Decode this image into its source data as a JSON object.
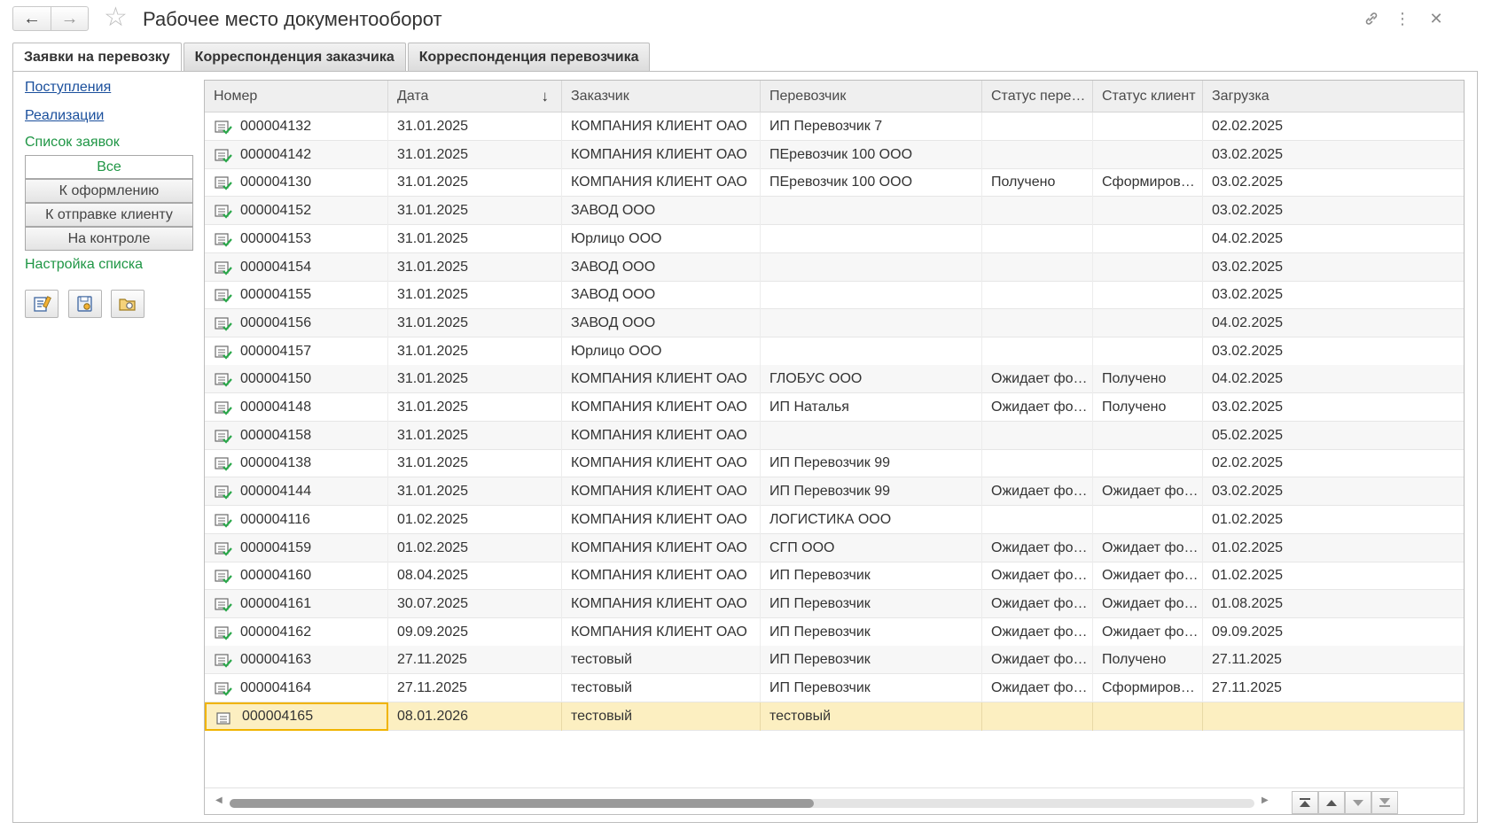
{
  "window": {
    "title": "Рабочее место документооборот",
    "back_icon": "arrow-left-icon",
    "forward_icon": "arrow-right-icon",
    "favorite_icon": "star-icon",
    "link_icon": "link-icon",
    "more_icon": "more-vertical-icon",
    "close_icon": "close-icon"
  },
  "tabs": [
    {
      "label": "Заявки на перевозку",
      "active": true
    },
    {
      "label": "Корреспонденция заказчика",
      "active": false
    },
    {
      "label": "Корреспонденция перевозчика",
      "active": false
    }
  ],
  "sidebar": {
    "links": [
      "Поступления",
      "Реализации"
    ],
    "list_title": "Список заявок",
    "filters": [
      {
        "label": "Все",
        "selected": true
      },
      {
        "label": "К оформлению",
        "selected": false
      },
      {
        "label": "К отправке клиенту",
        "selected": false
      },
      {
        "label": "На контроле",
        "selected": false
      }
    ],
    "settings_title": "Настройка списка",
    "settings_buttons": [
      "list-settings-icon",
      "settings-save-icon",
      "settings-load-icon"
    ]
  },
  "table": {
    "columns": [
      "Номер",
      "Дата",
      "Заказчик",
      "Перевозчик",
      "Статус пере…",
      "Статус клиент",
      "Загрузка"
    ],
    "sort_column": "Дата",
    "rows": [
      {
        "number": "000004132",
        "date": "31.01.2025",
        "customer": "КОМПАНИЯ КЛИЕНТ ОАО",
        "carrier": "ИП Перевозчик 7",
        "carrier_status": "",
        "client_status": "",
        "loading": "02.02.2025"
      },
      {
        "number": "000004142",
        "date": "31.01.2025",
        "customer": "КОМПАНИЯ КЛИЕНТ ОАО",
        "carrier": "ПЕревозчик 100 ООО",
        "carrier_status": "",
        "client_status": "",
        "loading": "03.02.2025"
      },
      {
        "number": "000004130",
        "date": "31.01.2025",
        "customer": "КОМПАНИЯ КЛИЕНТ ОАО",
        "carrier": "ПЕревозчик 100 ООО",
        "carrier_status": "Получено",
        "client_status": "Сформиров…",
        "loading": "03.02.2025"
      },
      {
        "number": "000004152",
        "date": "31.01.2025",
        "customer": "ЗАВОД ООО",
        "carrier": "",
        "carrier_status": "",
        "client_status": "",
        "loading": "03.02.2025"
      },
      {
        "number": "000004153",
        "date": "31.01.2025",
        "customer": "Юрлицо ООО",
        "carrier": "",
        "carrier_status": "",
        "client_status": "",
        "loading": "04.02.2025"
      },
      {
        "number": "000004154",
        "date": "31.01.2025",
        "customer": "ЗАВОД ООО",
        "carrier": "",
        "carrier_status": "",
        "client_status": "",
        "loading": "03.02.2025"
      },
      {
        "number": "000004155",
        "date": "31.01.2025",
        "customer": "ЗАВОД ООО",
        "carrier": "",
        "carrier_status": "",
        "client_status": "",
        "loading": "03.02.2025"
      },
      {
        "number": "000004156",
        "date": "31.01.2025",
        "customer": "ЗАВОД ООО",
        "carrier": "",
        "carrier_status": "",
        "client_status": "",
        "loading": "04.02.2025"
      },
      {
        "number": "000004157",
        "date": "31.01.2025",
        "customer": "Юрлицо ООО",
        "carrier": "",
        "carrier_status": "",
        "client_status": "",
        "loading": "03.02.2025"
      },
      {
        "number": "000004150",
        "date": "31.01.2025",
        "customer": "КОМПАНИЯ КЛИЕНТ ОАО",
        "carrier": "ГЛОБУС ООО",
        "carrier_status": "Ожидает фо…",
        "client_status": "Получено",
        "loading": "04.02.2025"
      },
      {
        "number": "000004148",
        "date": "31.01.2025",
        "customer": "КОМПАНИЯ КЛИЕНТ ОАО",
        "carrier": "ИП Наталья",
        "carrier_status": "Ожидает фо…",
        "client_status": "Получено",
        "loading": "03.02.2025"
      },
      {
        "number": "000004158",
        "date": "31.01.2025",
        "customer": "КОМПАНИЯ КЛИЕНТ ОАО",
        "carrier": "",
        "carrier_status": "",
        "client_status": "",
        "loading": "05.02.2025"
      },
      {
        "number": "000004138",
        "date": "31.01.2025",
        "customer": "КОМПАНИЯ КЛИЕНТ ОАО",
        "carrier": "ИП Перевозчик 99",
        "carrier_status": "",
        "client_status": "",
        "loading": "02.02.2025"
      },
      {
        "number": "000004144",
        "date": "31.01.2025",
        "customer": "КОМПАНИЯ КЛИЕНТ ОАО",
        "carrier": "ИП Перевозчик 99",
        "carrier_status": "Ожидает фо…",
        "client_status": "Ожидает фо…",
        "loading": "03.02.2025"
      },
      {
        "number": "000004116",
        "date": "01.02.2025",
        "customer": "КОМПАНИЯ КЛИЕНТ ОАО",
        "carrier": "ЛОГИСТИКА ООО",
        "carrier_status": "",
        "client_status": "",
        "loading": "01.02.2025"
      },
      {
        "number": "000004159",
        "date": "01.02.2025",
        "customer": "КОМПАНИЯ КЛИЕНТ ОАО",
        "carrier": "СГП ООО",
        "carrier_status": "Ожидает фо…",
        "client_status": "Ожидает фо…",
        "loading": "01.02.2025"
      },
      {
        "number": "000004160",
        "date": "08.04.2025",
        "customer": "КОМПАНИЯ КЛИЕНТ ОАО",
        "carrier": "ИП Перевозчик",
        "carrier_status": "Ожидает фо…",
        "client_status": "Ожидает фо…",
        "loading": "01.02.2025"
      },
      {
        "number": "000004161",
        "date": "30.07.2025",
        "customer": "КОМПАНИЯ КЛИЕНТ ОАО",
        "carrier": "ИП Перевозчик",
        "carrier_status": "Ожидает фо…",
        "client_status": "Ожидает фо…",
        "loading": "01.08.2025"
      },
      {
        "number": "000004162",
        "date": "09.09.2025",
        "customer": "КОМПАНИЯ КЛИЕНТ ОАО",
        "carrier": "ИП Перевозчик",
        "carrier_status": "Ожидает фо…",
        "client_status": "Ожидает фо…",
        "loading": "09.09.2025"
      },
      {
        "number": "000004163",
        "date": "27.11.2025",
        "customer": "тестовый",
        "carrier": "ИП Перевозчик",
        "carrier_status": "Ожидает фо…",
        "client_status": "Получено",
        "loading": "27.11.2025"
      },
      {
        "number": "000004164",
        "date": "27.11.2025",
        "customer": "тестовый",
        "carrier": "ИП Перевозчик",
        "carrier_status": "Ожидает фо…",
        "client_status": "Сформиров…",
        "loading": "27.11.2025"
      },
      {
        "number": "000004165",
        "date": "08.01.2026",
        "customer": "тестовый",
        "carrier": "тестовый",
        "carrier_status": "",
        "client_status": "",
        "loading": ""
      }
    ],
    "selected_index": 21,
    "posted_flags": [
      true,
      true,
      true,
      true,
      true,
      true,
      true,
      true,
      true,
      true,
      true,
      true,
      true,
      true,
      true,
      true,
      true,
      true,
      true,
      true,
      true,
      false
    ]
  },
  "scroll": {
    "horizontal_position": 0.57,
    "buttons": [
      "scroll-first-icon",
      "scroll-up-icon",
      "scroll-down-icon",
      "scroll-last-icon"
    ]
  },
  "colors": {
    "link": "#1a4f9c",
    "group_title": "#1f9645",
    "selected_row": "#fcefc1",
    "focus_border": "#f0b400",
    "posted_check": "#2aa84a"
  }
}
